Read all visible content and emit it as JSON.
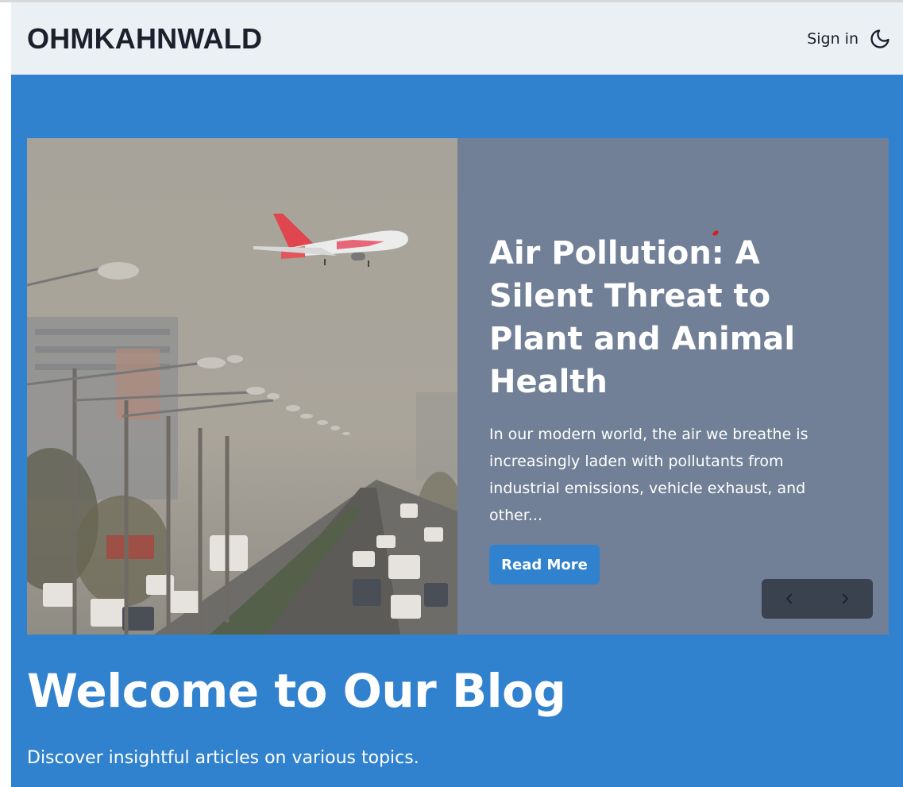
{
  "header": {
    "brand": "OHMKAHNWALD",
    "sign_in_label": "Sign in",
    "theme_icon": "moon-icon"
  },
  "carousel": {
    "slide": {
      "title": "Air Pollution: A Silent Threat to Plant and Animal Health",
      "excerpt": "In our modern world, the air we breathe is increasingly laden with pollutants from industrial emissions, vehicle exhaust, and other...",
      "read_more_label": "Read More",
      "image_icon": "smoggy-city-airplane-image"
    },
    "controls": {
      "prev_icon": "chevron-left-icon",
      "next_icon": "chevron-right-icon"
    }
  },
  "hero": {
    "title": "Welcome to Our Blog",
    "subtitle": "Discover insightful articles on various topics."
  },
  "colors": {
    "navbar_bg": "#ebf0f5",
    "hero_bg": "#3182ce",
    "panel_bg": "#718096",
    "button_bg": "#3182ce",
    "controls_bg": "#3a4250"
  }
}
